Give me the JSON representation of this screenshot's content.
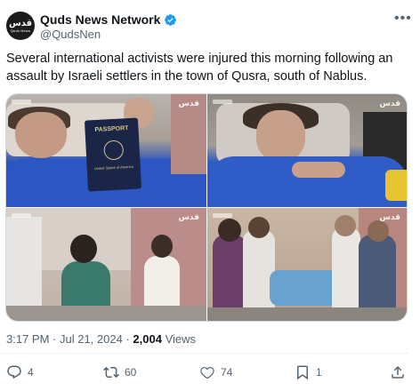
{
  "account": {
    "display_name": "Quds News Network",
    "handle": "@QudsNen",
    "avatar_logo_text": "قدس",
    "avatar_logo_sub": "Quds News",
    "verified_icon": "verified-badge-icon",
    "verified_color": "#1d9bf0",
    "more_icon": "more-dots-icon"
  },
  "tweet": {
    "text": "Several international activists were injured this morning following an assault by Israeli settlers in the town of Qusra, south of Nablus."
  },
  "media": {
    "watermark": "قدس",
    "photos": [
      {
        "passport_title": "PASSPORT",
        "passport_footer": "United States of America"
      },
      {},
      {},
      {}
    ]
  },
  "meta": {
    "time": "3:17 PM",
    "separator": " · ",
    "date": "Jul 21, 2024",
    "views_count": "2,004",
    "views_label": "Views"
  },
  "actions": {
    "reply": {
      "icon": "reply-icon",
      "count": "4"
    },
    "retweet": {
      "icon": "retweet-icon",
      "count": "60"
    },
    "like": {
      "icon": "heart-icon",
      "count": "74"
    },
    "bookmark": {
      "icon": "bookmark-icon",
      "count": "1"
    },
    "share": {
      "icon": "share-icon"
    }
  },
  "colors": {
    "text_primary": "#0f1419",
    "text_secondary": "#536471",
    "accent": "#1d9bf0"
  }
}
